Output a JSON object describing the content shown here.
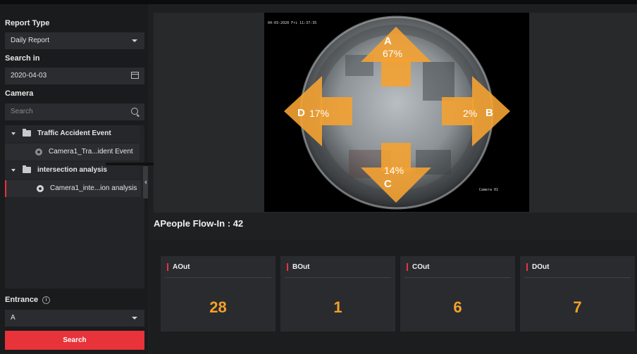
{
  "sidebar": {
    "report_type_label": "Report Type",
    "report_type_value": "Daily Report",
    "search_in_label": "Search in",
    "date_value": "2020-04-03",
    "camera_label": "Camera",
    "search_placeholder": "Search",
    "tree": [
      {
        "group": "Traffic Accident Event",
        "camera": "Camera1_Tra...ident Event"
      },
      {
        "group": "intersection analysis",
        "camera": "Camera1_inte...ion analysis"
      }
    ],
    "entrance_label": "Entrance",
    "entrance_value": "A",
    "search_button": "Search"
  },
  "video": {
    "timestamp": "04-03-2020 Fri 11:37:35",
    "camera_overlay": "Camera 01",
    "directions": {
      "A": {
        "letter": "A",
        "percent": "67%"
      },
      "B": {
        "letter": "B",
        "percent": "2%"
      },
      "C": {
        "letter": "C",
        "percent": "14%"
      },
      "D": {
        "letter": "D",
        "percent": "17%"
      }
    }
  },
  "flow_in": {
    "label": "APeople Flow-In :",
    "value": "42"
  },
  "cards": [
    {
      "title": "AOut",
      "value": "28"
    },
    {
      "title": "BOut",
      "value": "1"
    },
    {
      "title": "COut",
      "value": "6"
    },
    {
      "title": "DOut",
      "value": "7"
    }
  ],
  "colors": {
    "accent_red": "#e8333a",
    "value_orange": "#f3a12b",
    "arrow_orange": "#f4a232"
  }
}
